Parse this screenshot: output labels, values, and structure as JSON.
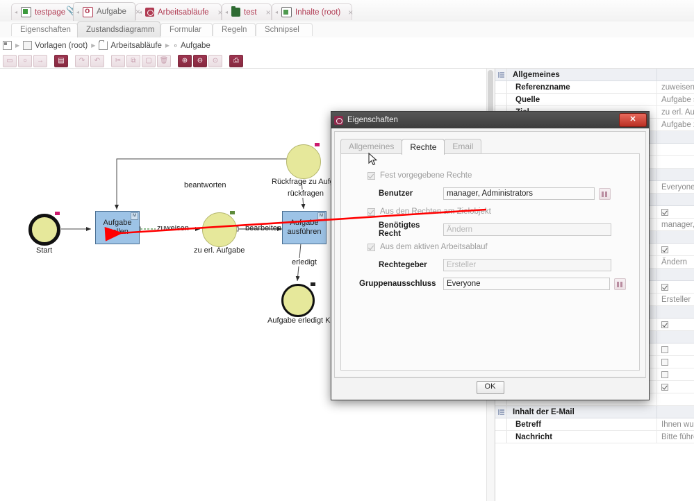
{
  "browser_tabs": [
    {
      "label": "testpage",
      "icon": "document-icon",
      "active": false,
      "has_attachment": true
    },
    {
      "label": "Aufgabe",
      "icon": "task-icon",
      "active": true,
      "has_attachment": false
    },
    {
      "label": "Arbeitsabläufe",
      "icon": "workflow-icon",
      "active": false,
      "has_attachment": false
    },
    {
      "label": "test",
      "icon": "folder-icon",
      "active": false,
      "has_attachment": false
    },
    {
      "label": "Inhalte (root)",
      "icon": "content-icon",
      "active": false,
      "has_attachment": false
    }
  ],
  "sub_tabs": [
    {
      "label": "Eigenschaften",
      "active": false
    },
    {
      "label": "Zustandsdiagramm",
      "active": true
    },
    {
      "label": "Formular",
      "active": false
    },
    {
      "label": "Regeln",
      "active": false
    },
    {
      "label": "Schnipsel",
      "active": false
    }
  ],
  "breadcrumb": [
    {
      "label": "Vorlagen (root)",
      "icon": "template-root-icon"
    },
    {
      "label": "Arbeitsabläufe",
      "icon": "folder-icon"
    },
    {
      "label": "Aufgabe",
      "icon": "task-icon"
    }
  ],
  "toolbar": [
    {
      "name": "add-state-icon",
      "glyph": "▭",
      "enabled": false
    },
    {
      "name": "add-node-icon",
      "glyph": "○",
      "enabled": false
    },
    {
      "name": "add-transition-icon",
      "glyph": "→",
      "enabled": false
    },
    {
      "name": "properties-icon",
      "glyph": "▤",
      "enabled": true
    },
    {
      "name": "undo-icon",
      "glyph": "↷",
      "enabled": false
    },
    {
      "name": "redo-icon",
      "glyph": "↶",
      "enabled": false
    },
    {
      "name": "cut-icon",
      "glyph": "✂",
      "enabled": false
    },
    {
      "name": "copy-icon",
      "glyph": "⧉",
      "enabled": false
    },
    {
      "name": "paste-icon",
      "glyph": "▢",
      "enabled": false
    },
    {
      "name": "delete-icon",
      "glyph": "🗑",
      "enabled": false
    },
    {
      "name": "zoom-in-icon",
      "glyph": "⊕",
      "enabled": true
    },
    {
      "name": "zoom-out-icon",
      "glyph": "⊖",
      "enabled": true
    },
    {
      "name": "zoom-reset-icon",
      "glyph": "⊙",
      "enabled": false
    },
    {
      "name": "print-icon",
      "glyph": "⎙",
      "enabled": true
    }
  ],
  "diagram": {
    "nodes": [
      {
        "id": "start",
        "type": "start-node",
        "label": "Start",
        "badge": "pink"
      },
      {
        "id": "aufgabe-stellen",
        "type": "state-rect",
        "label": "Aufgabe stellen",
        "marker": "M"
      },
      {
        "id": "zu-erl-aufgabe",
        "type": "circle-node",
        "label": "zu erl. Aufgabe",
        "badge": "green"
      },
      {
        "id": "aufgabe-ausfuehren",
        "type": "state-rect",
        "label": "Aufgabe ausführen",
        "marker": "M"
      },
      {
        "id": "rueckfrage",
        "type": "circle-node",
        "label": "Rückfrage zu Aufgabe",
        "badge": "pink"
      },
      {
        "id": "aufgabe-erledigt-kopie",
        "type": "end-node",
        "label": "Aufgabe erledigt Kopi",
        "badge": "dark"
      }
    ],
    "edges": [
      {
        "label": "zuweisen"
      },
      {
        "label": "bearbeiten"
      },
      {
        "label": "rückfragen"
      },
      {
        "label": "beantworten"
      },
      {
        "label": "erledigt"
      }
    ]
  },
  "properties_panel": {
    "rows": [
      {
        "kind": "group",
        "name": "Allgemeines",
        "value": ""
      },
      {
        "kind": "text",
        "name": "Referenzname",
        "value": "zuweisen"
      },
      {
        "kind": "text",
        "name": "Quelle",
        "value": "Aufgabe ste"
      },
      {
        "kind": "text",
        "name": "Ziel",
        "value": "zu erl. Aufga"
      },
      {
        "kind": "text",
        "name": "",
        "value": "Aufgabe zu"
      },
      {
        "kind": "group",
        "name": "",
        "value": ""
      },
      {
        "kind": "text",
        "name": "",
        "value": ""
      },
      {
        "kind": "text",
        "name": "",
        "value": ""
      },
      {
        "kind": "group",
        "name": "",
        "value": ""
      },
      {
        "kind": "text",
        "name": "",
        "value": "Everyone"
      },
      {
        "kind": "group",
        "name": "",
        "value": ""
      },
      {
        "kind": "check",
        "name": "",
        "value": "",
        "checked": true
      },
      {
        "kind": "text",
        "name": "",
        "value": "manager, A"
      },
      {
        "kind": "group",
        "name": "",
        "value": ""
      },
      {
        "kind": "check",
        "name": "",
        "value": "",
        "checked": true
      },
      {
        "kind": "text",
        "name": "",
        "value": "Ändern"
      },
      {
        "kind": "group",
        "name": "",
        "value": ""
      },
      {
        "kind": "check",
        "name": "",
        "value": "",
        "checked": true
      },
      {
        "kind": "text",
        "name": "",
        "value": "Ersteller"
      },
      {
        "kind": "group",
        "name": "",
        "value": ""
      },
      {
        "kind": "check",
        "name": "",
        "value": "",
        "checked": true
      },
      {
        "kind": "group",
        "name": "",
        "value": ""
      },
      {
        "kind": "check",
        "name": "",
        "value": "",
        "checked": false
      },
      {
        "kind": "check",
        "name": "",
        "value": "",
        "checked": false
      },
      {
        "kind": "check",
        "name": "",
        "value": "",
        "checked": false
      },
      {
        "kind": "check",
        "name": "",
        "value": "",
        "checked": true
      },
      {
        "kind": "text",
        "name": "",
        "value": ""
      },
      {
        "kind": "group",
        "name": "Inhalt der E-Mail",
        "value": ""
      },
      {
        "kind": "text",
        "name": "Betreff",
        "value": "Ihnen wurd"
      },
      {
        "kind": "text",
        "name": "Nachricht",
        "value": "Bitte führen"
      }
    ]
  },
  "dialog": {
    "title": "Eigenschaften",
    "close_label": "✕",
    "tabs": [
      {
        "label": "Allgemeines",
        "active": false
      },
      {
        "label": "Rechte",
        "active": true
      },
      {
        "label": "Email",
        "active": false
      }
    ],
    "fields": {
      "fixed_rights_label": "Fest vorgegebene Rechte",
      "fixed_rights_checked": true,
      "benutzer_label": "Benutzer",
      "benutzer_value": "manager, Administrators",
      "target_rights_label": "Aus den Rechten am Zielobjekt",
      "target_rights_checked": true,
      "benoetigtes_recht_label": "Benötigtes Recht",
      "benoetigtes_recht_value": "Ändern",
      "active_workflow_label": "Aus dem aktiven Arbeitsablauf",
      "active_workflow_checked": true,
      "rechtegeber_label": "Rechtegeber",
      "rechtegeber_value": "Ersteller",
      "gruppenausschluss_label": "Gruppenausschluss",
      "gruppenausschluss_value": "Everyone"
    },
    "ok_label": "OK"
  }
}
